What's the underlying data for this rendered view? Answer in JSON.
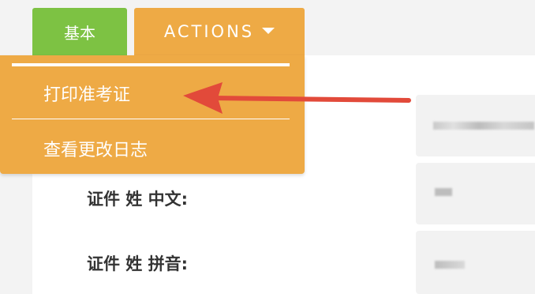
{
  "tabs": {
    "basic_label": "基本",
    "actions_label": "ACTIONS"
  },
  "dropdown": {
    "items": [
      {
        "label": "打印准考证"
      },
      {
        "label": "查看更改日志"
      }
    ]
  },
  "form": {
    "fields": [
      {
        "label": "证件 姓 中文:"
      },
      {
        "label": "证件 姓 拼音:"
      }
    ]
  },
  "icons": {
    "actions_caret": "caret-down-icon",
    "annotation_arrow": "red-arrow-annotation"
  },
  "colors": {
    "basic_tab": "#7dc243",
    "actions_tab": "#eeaa45",
    "arrow": "#e24a3a"
  }
}
